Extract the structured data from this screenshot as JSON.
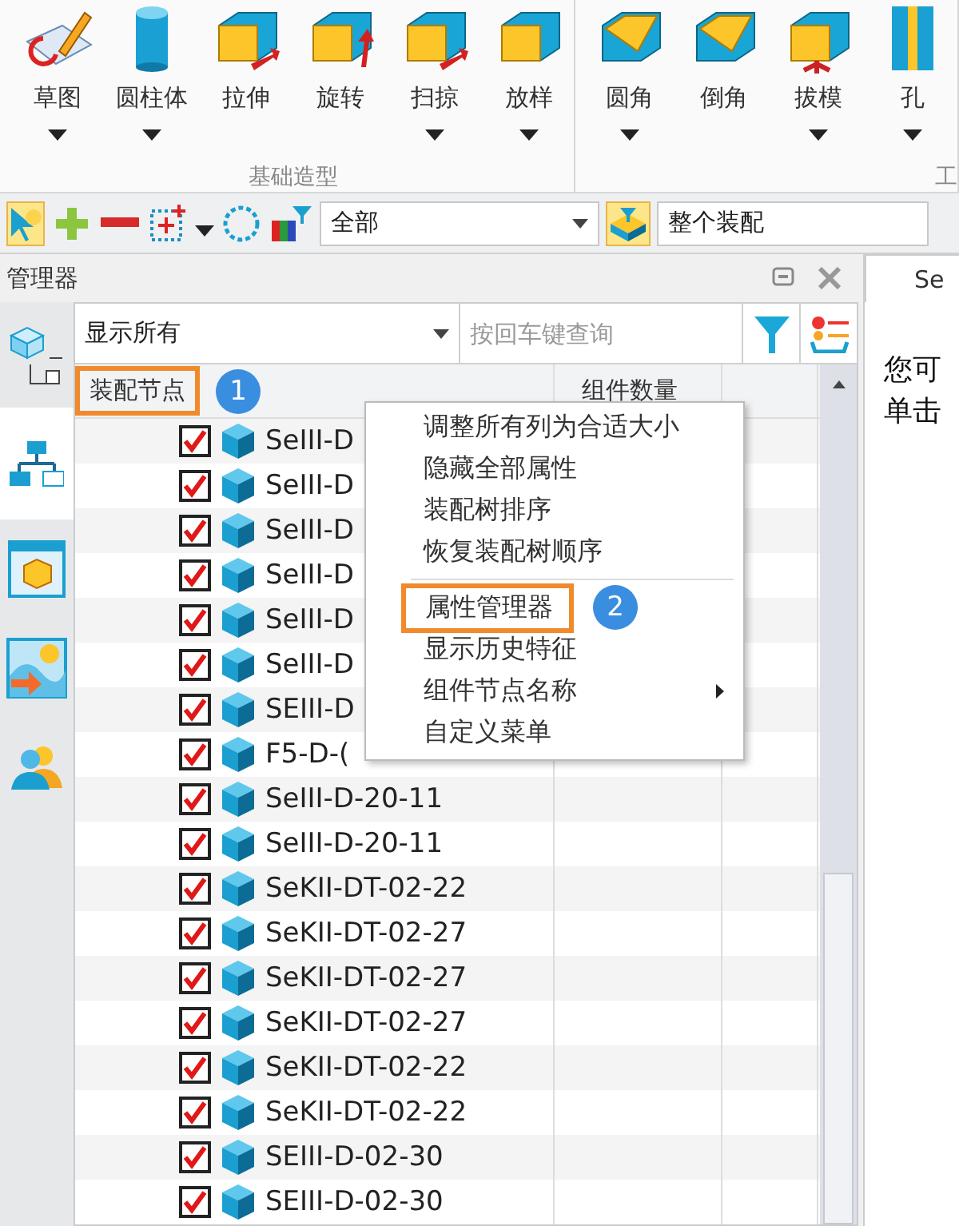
{
  "ribbon": {
    "groups": [
      {
        "label": "基础造型",
        "tools": [
          {
            "label": "草图",
            "dropdown": true
          },
          {
            "label": "圆柱体",
            "dropdown": true
          },
          {
            "label": "拉伸",
            "dropdown": false
          },
          {
            "label": "旋转",
            "dropdown": false
          },
          {
            "label": "扫掠",
            "dropdown": true
          },
          {
            "label": "放样",
            "dropdown": true
          }
        ]
      },
      {
        "label": "工",
        "tools": [
          {
            "label": "圆角",
            "dropdown": true
          },
          {
            "label": "倒角",
            "dropdown": false
          },
          {
            "label": "拔模",
            "dropdown": true
          },
          {
            "label": "孔",
            "dropdown": true
          }
        ]
      }
    ]
  },
  "toolbar": {
    "filter": "全部",
    "scope": "整个装配"
  },
  "manager": {
    "title": "管理器",
    "side_tabs": [
      {
        "selected": true
      },
      {
        "selected": false
      },
      {
        "selected": false
      },
      {
        "selected": false
      }
    ]
  },
  "tree": {
    "show_filter": "显示所有",
    "search": {
      "placeholder": "按回车键查询"
    },
    "columns": [
      {
        "label": "装配节点",
        "highlighted": true,
        "callout": "1"
      },
      {
        "label": "组件数量",
        "highlighted": false
      }
    ],
    "rows": [
      {
        "name": "SeIII-D",
        "checked": true
      },
      {
        "name": "SeIII-D",
        "checked": true
      },
      {
        "name": "SeIII-D",
        "checked": true
      },
      {
        "name": "SeIII-D",
        "checked": true
      },
      {
        "name": "SeIII-D",
        "checked": true
      },
      {
        "name": "SeIII-D",
        "checked": true
      },
      {
        "name": "SEIII-D",
        "checked": true
      },
      {
        "name": "F5-D-(",
        "checked": true
      },
      {
        "name": "SeIII-D-20-11",
        "checked": true
      },
      {
        "name": "SeIII-D-20-11",
        "checked": true
      },
      {
        "name": "SeKII-DT-02-22",
        "checked": true
      },
      {
        "name": "SeKII-DT-02-27",
        "checked": true
      },
      {
        "name": "SeKII-DT-02-27",
        "checked": true
      },
      {
        "name": "SeKII-DT-02-27",
        "checked": true
      },
      {
        "name": "SeKII-DT-02-22",
        "checked": true
      },
      {
        "name": "SeKII-DT-02-22",
        "checked": true
      },
      {
        "name": "SEIII-D-02-30",
        "checked": true
      },
      {
        "name": "SEIII-D-02-30",
        "checked": true
      }
    ]
  },
  "context_menu": {
    "items": [
      {
        "kind": "command",
        "label": "调整所有列为合适大小",
        "highlighted": false
      },
      {
        "kind": "command",
        "label": "隐藏全部属性",
        "highlighted": false
      },
      {
        "kind": "command",
        "label": "装配树排序",
        "highlighted": false
      },
      {
        "kind": "command",
        "label": "恢复装配树顺序",
        "highlighted": false
      },
      {
        "kind": "separator"
      },
      {
        "kind": "command",
        "label": "属性管理器",
        "highlighted": true,
        "callout": "2"
      },
      {
        "kind": "command",
        "label": "显示历史特征",
        "highlighted": false
      },
      {
        "kind": "submenu",
        "label": "组件节点名称",
        "highlighted": false
      },
      {
        "kind": "command",
        "label": "自定义菜单",
        "highlighted": false
      }
    ]
  },
  "document": {
    "tab": "Se",
    "lines": [
      "您可",
      "单击"
    ]
  }
}
